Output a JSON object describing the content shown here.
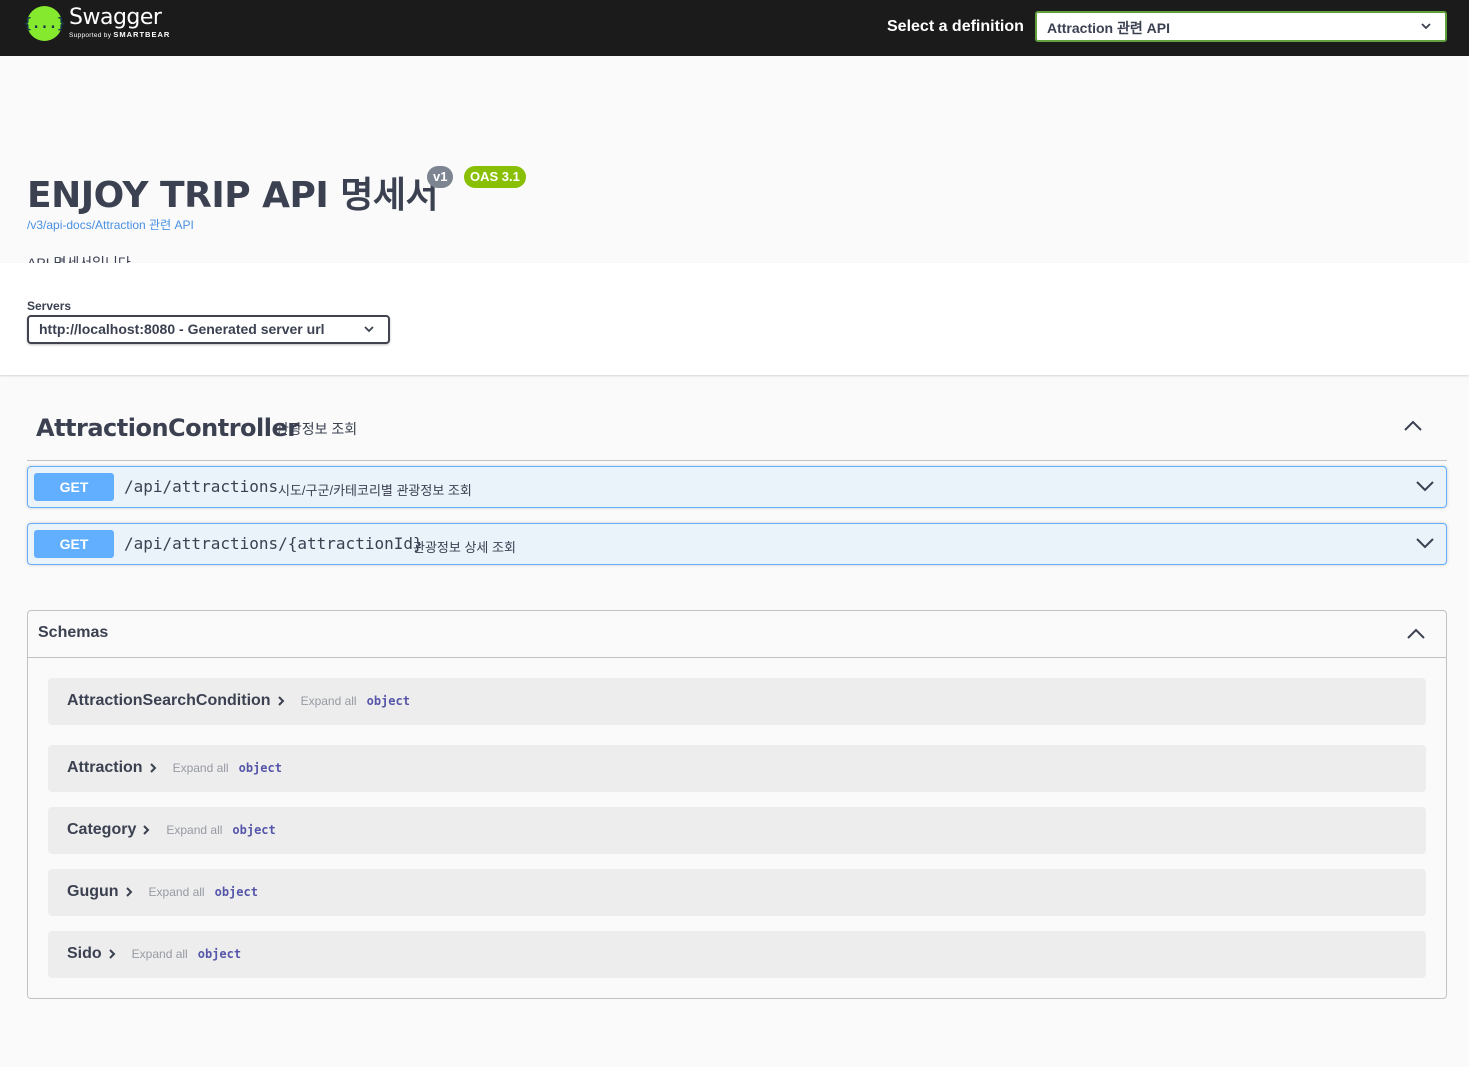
{
  "topbar": {
    "brand": "Swagger",
    "supported_by": "Supported by",
    "smartbear": "SMARTBEAR",
    "logo_glyph": "{...}",
    "definition_label": "Select a definition",
    "definition_value": "Attraction 관련 API"
  },
  "info": {
    "title": "ENJOY TRIP API 명세서",
    "version_badge": "v1",
    "oas_badge": "OAS 3.1",
    "spec_url": "/v3/api-docs/Attraction 관련 API",
    "description": "API 명세서입니다."
  },
  "servers": {
    "label": "Servers",
    "selected": "http://localhost:8080 - Generated server url"
  },
  "tag": {
    "name": "AttractionController",
    "description": "관광정보 조회",
    "operations": [
      {
        "method": "GET",
        "path": "/api/attractions",
        "summary": "시도/구군/카테코리별 관광정보 조회"
      },
      {
        "method": "GET",
        "path": "/api/attractions/{attractionId}",
        "summary": "관광정보 상세 조회"
      }
    ]
  },
  "schemas": {
    "title": "Schemas",
    "expand_all": "Expand all",
    "items": [
      {
        "name": "AttractionSearchCondition",
        "type": "object"
      },
      {
        "name": "Attraction",
        "type": "object"
      },
      {
        "name": "Category",
        "type": "object"
      },
      {
        "name": "Gugun",
        "type": "object"
      },
      {
        "name": "Sido",
        "type": "object"
      }
    ]
  },
  "colors": {
    "topbar": "#1b1b1b",
    "logo": "#85ea2d",
    "get": "#61affe",
    "oas_badge": "#89bf04",
    "version_badge": "#7d8492",
    "link": "#4990e2"
  },
  "icons": [
    "chevron-down-icon",
    "chevron-up-icon",
    "chevron-right-icon"
  ]
}
